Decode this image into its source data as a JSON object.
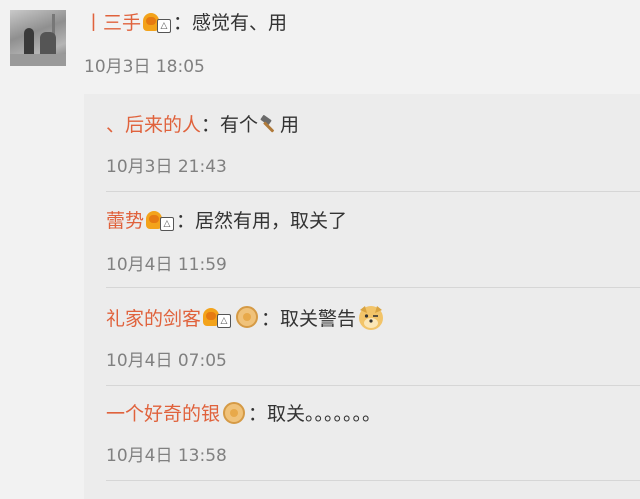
{
  "main_comment": {
    "user": "丨三手",
    "colon": "：",
    "text": "感觉有、用",
    "time": "10月3日 18:05"
  },
  "replies": [
    {
      "user": "、后来的人",
      "colon": "：",
      "text_before": "有个",
      "text_after": "用",
      "time": "10月3日 21:43",
      "icons": [
        "hammer-icon"
      ]
    },
    {
      "user": "蕾势",
      "colon": "：",
      "text": "居然有用，取关了",
      "time": "10月4日 11:59",
      "icons": [
        "vip-badge-icon"
      ]
    },
    {
      "user": "礼家的剑客",
      "colon": "：",
      "text": "取关警告",
      "time": "10月4日 07:05",
      "icons": [
        "vip-badge-icon",
        "fan-medal-icon",
        "doge-emoji-icon"
      ]
    },
    {
      "user": "一个好奇的银",
      "colon": "：",
      "text": "取关。。。。。。。",
      "time": "10月4日 13:58",
      "icons": [
        "fan-medal-icon"
      ]
    }
  ],
  "colors": {
    "username": "#e0623c",
    "time": "#808080",
    "text": "#333333",
    "panel_bg": "#ececec",
    "page_bg": "#f2f2f2"
  }
}
